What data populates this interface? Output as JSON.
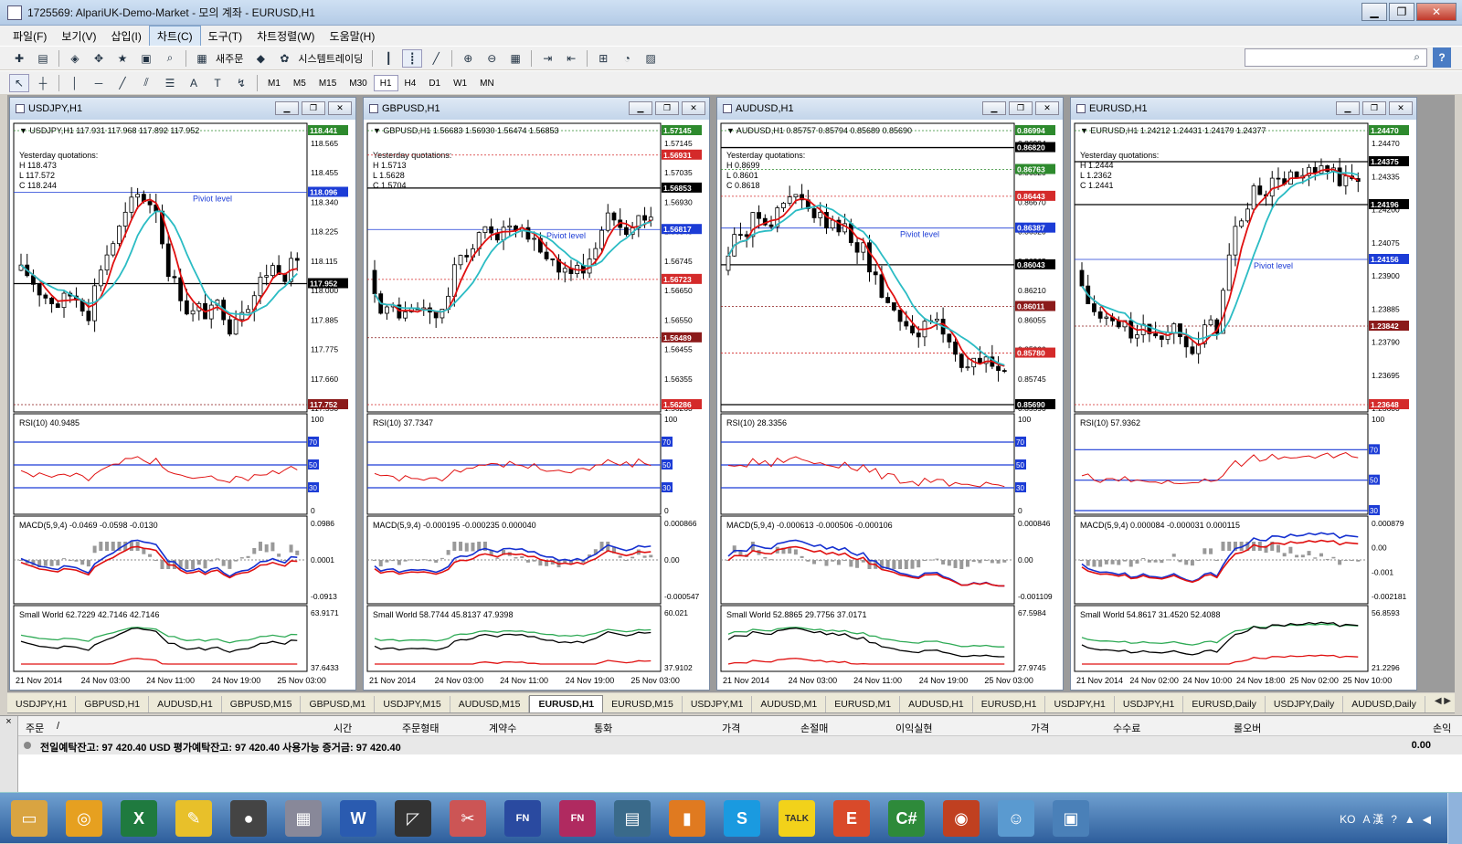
{
  "window": {
    "title": "1725569: AlpariUK-Demo-Market - 모의 계좌 - EURUSD,H1"
  },
  "menu": [
    "파일(F)",
    "보기(V)",
    "삽입(I)",
    "차트(C)",
    "도구(T)",
    "차트정렬(W)",
    "도움말(H)"
  ],
  "menu_active": "차트(C)",
  "toolbar": {
    "new_order": "새주문",
    "expert": "시스템트레이딩"
  },
  "timeframes": [
    "M1",
    "M5",
    "M15",
    "M30",
    "H1",
    "H4",
    "D1",
    "W1",
    "MN"
  ],
  "timeframe_active": "H1",
  "charts": [
    {
      "title": "USDJPY,H1",
      "header": "USDJPY,H1  117.931 117.968 117.892 117.952",
      "yest": [
        "Yesterday quotations:",
        "H 118.473",
        "L 117.572",
        "C 118.244"
      ],
      "prices": [
        "118.565",
        "118.455",
        "118.340",
        "118.225",
        "118.115",
        "118.000",
        "117.885",
        "117.775",
        "117.660",
        "117.550"
      ],
      "tags": [
        {
          "v": "118.441",
          "c": "#2d8a2d"
        },
        {
          "v": "118.096",
          "c": "#1c3cd6"
        },
        {
          "v": "117.952",
          "c": "#000"
        },
        {
          "v": "117.752",
          "c": "#8b1a1a"
        }
      ],
      "pivot_label": "Piviot level",
      "rsi": "RSI(10) 40.9485",
      "macd": "MACD(5,9,4) -0.0469 -0.0598 -0.0130",
      "macd_ticks": [
        "0.0986",
        "0.0001",
        "-0.0913"
      ],
      "sw": "Small World 62.7229 42.7146 42.7146",
      "sw_ticks": [
        "63.9171",
        "37.6433"
      ],
      "dates": [
        "21 Nov 2014",
        "24 Nov 03:00",
        "24 Nov 11:00",
        "24 Nov 19:00",
        "25 Nov 03:00"
      ],
      "rsi_ticks": [
        "100",
        "70",
        "50",
        "30",
        "0"
      ]
    },
    {
      "title": "GBPUSD,H1",
      "header": "GBPUSD,H1  1.56683 1.56930 1.56474 1.56853",
      "yest": [
        "Yesterday quotations:",
        "H 1.5713",
        "L 1.5628",
        "C 1.5704"
      ],
      "prices": [
        "1.57145",
        "1.57035",
        "1.56930",
        "1.56840",
        "1.56745",
        "1.56650",
        "1.56550",
        "1.56455",
        "1.56355",
        "1.56260"
      ],
      "tags": [
        {
          "v": "1.57145",
          "c": "#2d8a2d"
        },
        {
          "v": "1.56931",
          "c": "#d42a2a"
        },
        {
          "v": "1.56853",
          "c": "#000"
        },
        {
          "v": "1.56817",
          "c": "#1c3cd6"
        },
        {
          "v": "1.56723",
          "c": "#d42a2a"
        },
        {
          "v": "1.56489",
          "c": "#8b1a1a"
        },
        {
          "v": "1.56286",
          "c": "#d42a2a"
        }
      ],
      "pivot_label": "Piviot level",
      "rsi": "RSI(10) 37.7347",
      "macd": "MACD(5,9,4) -0.000195 -0.000235 0.000040",
      "macd_ticks": [
        "0.000866",
        "0.00",
        "-0.000547"
      ],
      "sw": "Small World 58.7744 45.8137 47.9398",
      "sw_ticks": [
        "60.021",
        "37.9102"
      ],
      "dates": [
        "21 Nov 2014",
        "24 Nov 03:00",
        "24 Nov 11:00",
        "24 Nov 19:00",
        "25 Nov 03:00"
      ],
      "rsi_ticks": [
        "100",
        "70",
        "50",
        "30",
        "0"
      ]
    },
    {
      "title": "AUDUSD,H1",
      "header": "AUDUSD,H1  0.85757 0.85794 0.85689 0.85690",
      "yest": [
        "Yesterday quotations:",
        "H 0.8699",
        "L 0.8601",
        "C 0.8618"
      ],
      "prices": [
        "0.86994",
        "0.86820",
        "0.86670",
        "0.86520",
        "0.86365",
        "0.86210",
        "0.86055",
        "0.85900",
        "0.85745",
        "0.85590"
      ],
      "tags": [
        {
          "v": "0.86994",
          "c": "#2d8a2d"
        },
        {
          "v": "0.86820",
          "c": "#000"
        },
        {
          "v": "0.86763",
          "c": "#2d8a2d"
        },
        {
          "v": "0.86443",
          "c": "#d42a2a"
        },
        {
          "v": "0.86387",
          "c": "#1c3cd6"
        },
        {
          "v": "0.86043",
          "c": "#000"
        },
        {
          "v": "0.86011",
          "c": "#8b1a1a"
        },
        {
          "v": "0.85780",
          "c": "#d42a2a"
        },
        {
          "v": "0.85690",
          "c": "#000"
        }
      ],
      "pivot_label": "Piviot level",
      "rsi": "RSI(10) 28.3356",
      "macd": "MACD(5,9,4) -0.000613 -0.000506 -0.000106",
      "macd_ticks": [
        "0.000846",
        "0.00",
        "-0.001109"
      ],
      "sw": "Small World 52.8865 29.7756 37.0171",
      "sw_ticks": [
        "67.5984",
        "27.9745"
      ],
      "dates": [
        "21 Nov 2014",
        "24 Nov 03:00",
        "24 Nov 11:00",
        "24 Nov 19:00",
        "25 Nov 03:00"
      ],
      "rsi_ticks": [
        "100",
        "70",
        "50",
        "30",
        "0"
      ]
    },
    {
      "title": "EURUSD,H1",
      "header": "EURUSD,H1  1.24212 1.24431 1.24179 1.24377",
      "yest": [
        "Yesterday quotations:",
        "H 1.2444",
        "L 1.2362",
        "C 1.2441"
      ],
      "prices": [
        "1.24470",
        "1.24335",
        "1.24200",
        "1.24075",
        "1.23900",
        "1.23885",
        "1.23790",
        "1.23695",
        "1.23600"
      ],
      "tags": [
        {
          "v": "1.24470",
          "c": "#2d8a2d"
        },
        {
          "v": "1.24375",
          "c": "#000"
        },
        {
          "v": "1.24196",
          "c": "#000"
        },
        {
          "v": "1.24156",
          "c": "#1c3cd6"
        },
        {
          "v": "1.23842",
          "c": "#8b1a1a"
        },
        {
          "v": "1.23648",
          "c": "#d42a2a"
        }
      ],
      "pivot_label": "Piviot level",
      "rsi": "RSI(10) 57.9362",
      "macd": "MACD(5,9,4) 0.000084 -0.000031 0.000115",
      "macd_ticks": [
        "0.000879",
        "0.00",
        "-0.001",
        "-0.002181"
      ],
      "sw": "Small World 54.8617 31.4520 52.4088",
      "sw_ticks": [
        "56.8593",
        "21.2296"
      ],
      "dates": [
        "21 Nov 2014",
        "24 Nov 02:00",
        "24 Nov 10:00",
        "24 Nov 18:00",
        "25 Nov 02:00",
        "25 Nov 10:00"
      ],
      "rsi_ticks": [
        "100",
        "70",
        "50",
        "30"
      ]
    }
  ],
  "tabs": [
    "USDJPY,H1",
    "GBPUSD,H1",
    "AUDUSD,H1",
    "GBPUSD,M15",
    "GBPUSD,M1",
    "USDJPY,M15",
    "AUDUSD,M15",
    "EURUSD,H1",
    "EURUSD,M15",
    "USDJPY,M1",
    "AUDUSD,M1",
    "EURUSD,M1",
    "AUDUSD,H1",
    "EURUSD,H1",
    "USDJPY,H1",
    "USDJPY,H1",
    "EURUSD,Daily",
    "USDJPY,Daily",
    "AUDUSD,Daily"
  ],
  "tab_active": 7,
  "terminal": {
    "side": "×",
    "columns": [
      "주문",
      "/",
      "시간",
      "주문형태",
      "계약수",
      "통화",
      "가격",
      "손절매",
      "이익실현",
      "가격",
      "수수료",
      "롤오버",
      "손익"
    ],
    "balance": "전일예탁잔고: 97 420.40 USD  평가예탁잔고: 97 420.40  사용가능 증거금: 97 420.40",
    "value": "0.00"
  },
  "taskbar": {
    "lang": "KO"
  },
  "colors": {
    "ma_red": "#e01010",
    "ma_cyan": "#2bbcc4",
    "level_blue": "#1c3cd6",
    "sw_green": "#2eaa55",
    "bull_candle": "#ffffff",
    "bear_candle": "#000000"
  }
}
